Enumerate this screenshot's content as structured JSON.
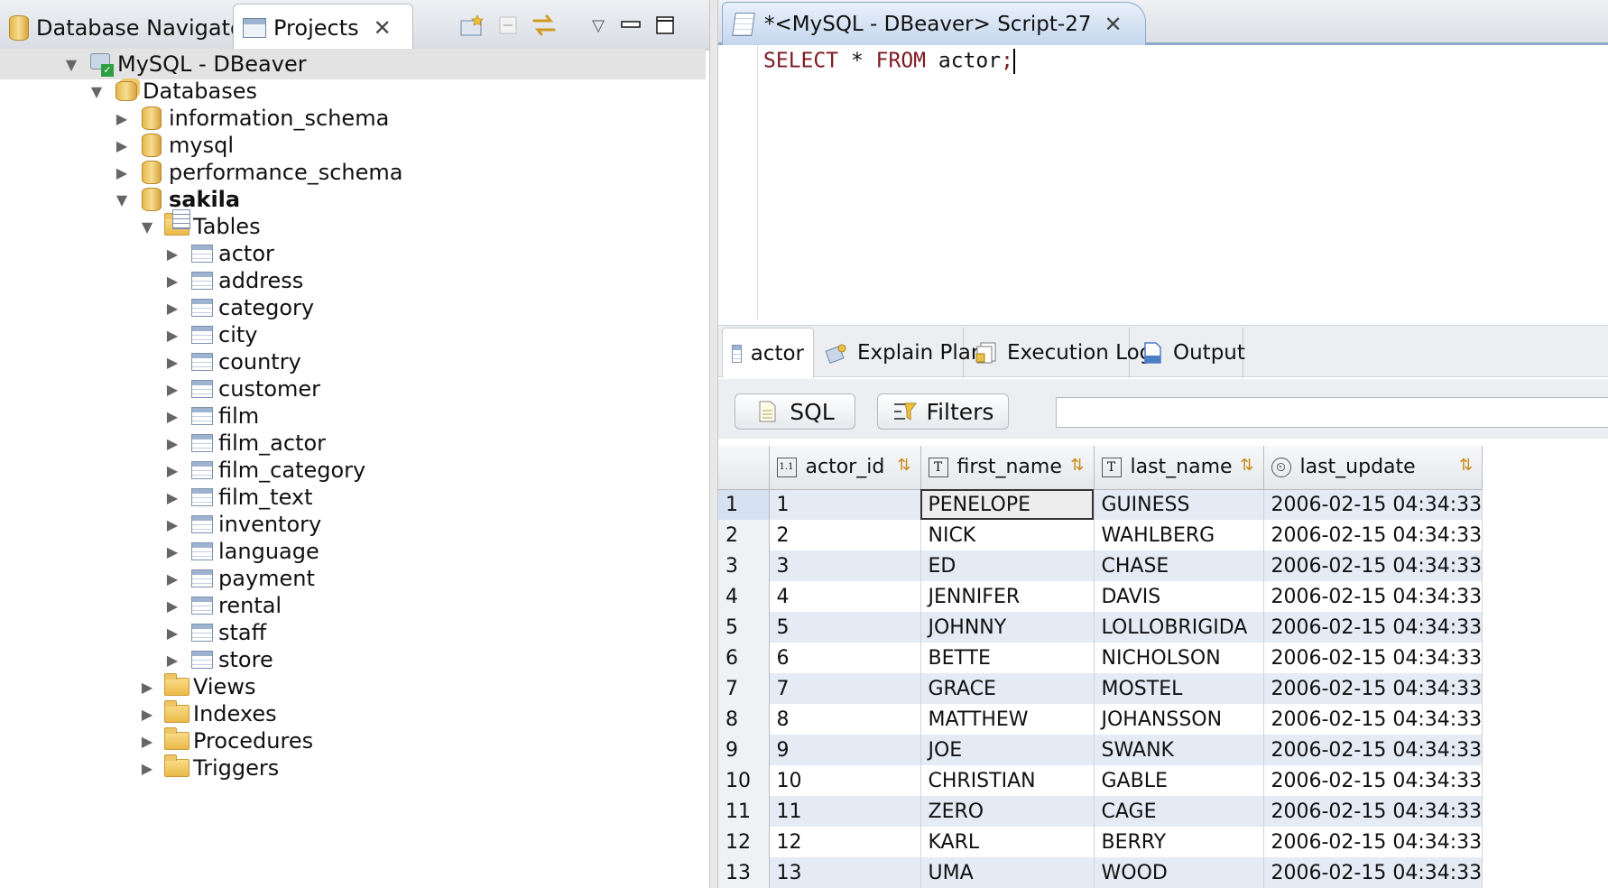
{
  "left_panel": {
    "tabs": [
      {
        "label": "Database Navigator",
        "icon": "database-navigator-icon"
      },
      {
        "label": "Projects",
        "icon": "projects-icon"
      }
    ],
    "toolbar_icons": [
      "new-folder-icon",
      "collapse-all-icon",
      "link-with-editor-icon",
      "view-menu-icon",
      "minimize-icon",
      "maximize-icon"
    ]
  },
  "tree": [
    {
      "label": "MySQL - DBeaver",
      "depth": 0,
      "expanded": true,
      "icon": "connection-icon",
      "selected": true
    },
    {
      "label": "Databases",
      "depth": 1,
      "expanded": true,
      "icon": "databases-icon"
    },
    {
      "label": "information_schema",
      "depth": 2,
      "expanded": false,
      "icon": "database-icon"
    },
    {
      "label": "mysql",
      "depth": 2,
      "expanded": false,
      "icon": "database-icon"
    },
    {
      "label": "performance_schema",
      "depth": 2,
      "expanded": false,
      "icon": "database-icon"
    },
    {
      "label": "sakila",
      "depth": 2,
      "expanded": true,
      "icon": "database-icon",
      "bold": true
    },
    {
      "label": "Tables",
      "depth": 3,
      "expanded": true,
      "icon": "tables-folder-icon"
    },
    {
      "label": "actor",
      "depth": 4,
      "expanded": false,
      "icon": "table-icon"
    },
    {
      "label": "address",
      "depth": 4,
      "expanded": false,
      "icon": "table-icon"
    },
    {
      "label": "category",
      "depth": 4,
      "expanded": false,
      "icon": "table-icon"
    },
    {
      "label": "city",
      "depth": 4,
      "expanded": false,
      "icon": "table-icon"
    },
    {
      "label": "country",
      "depth": 4,
      "expanded": false,
      "icon": "table-icon"
    },
    {
      "label": "customer",
      "depth": 4,
      "expanded": false,
      "icon": "table-icon"
    },
    {
      "label": "film",
      "depth": 4,
      "expanded": false,
      "icon": "table-icon"
    },
    {
      "label": "film_actor",
      "depth": 4,
      "expanded": false,
      "icon": "table-icon"
    },
    {
      "label": "film_category",
      "depth": 4,
      "expanded": false,
      "icon": "table-icon"
    },
    {
      "label": "film_text",
      "depth": 4,
      "expanded": false,
      "icon": "table-icon"
    },
    {
      "label": "inventory",
      "depth": 4,
      "expanded": false,
      "icon": "table-icon"
    },
    {
      "label": "language",
      "depth": 4,
      "expanded": false,
      "icon": "table-icon"
    },
    {
      "label": "payment",
      "depth": 4,
      "expanded": false,
      "icon": "table-icon"
    },
    {
      "label": "rental",
      "depth": 4,
      "expanded": false,
      "icon": "table-icon"
    },
    {
      "label": "staff",
      "depth": 4,
      "expanded": false,
      "icon": "table-icon"
    },
    {
      "label": "store",
      "depth": 4,
      "expanded": false,
      "icon": "table-icon"
    },
    {
      "label": "Views",
      "depth": 3,
      "expanded": false,
      "icon": "views-folder-icon"
    },
    {
      "label": "Indexes",
      "depth": 3,
      "expanded": false,
      "icon": "folder-icon"
    },
    {
      "label": "Procedures",
      "depth": 3,
      "expanded": false,
      "icon": "folder-icon"
    },
    {
      "label": "Triggers",
      "depth": 3,
      "expanded": false,
      "icon": "folder-icon"
    }
  ],
  "editor": {
    "tab_title": "*<MySQL - DBeaver> Script-27",
    "sql": {
      "kw1": "SELECT",
      "star": " * ",
      "kw2": "FROM",
      "rest": " actor",
      "semi": ";"
    }
  },
  "result_tabs": [
    {
      "label": "actor",
      "icon": "table-icon",
      "active": true
    },
    {
      "label": "Explain Plan",
      "icon": "explain-plan-icon"
    },
    {
      "label": "Execution Log",
      "icon": "execution-log-icon"
    },
    {
      "label": "Output",
      "icon": "output-icon"
    }
  ],
  "filter_bar": {
    "sql_button": "SQL",
    "filters_button": "Filters",
    "filter_value": ""
  },
  "grid": {
    "columns": [
      {
        "name": "actor_id",
        "type_icon": "1.1"
      },
      {
        "name": "first_name",
        "type_icon": "T"
      },
      {
        "name": "last_name",
        "type_icon": "T"
      },
      {
        "name": "last_update",
        "type_icon": "⏲"
      }
    ],
    "rows": [
      {
        "n": "1",
        "actor_id": "1",
        "first_name": "PENELOPE",
        "last_name": "GUINESS",
        "last_update": "2006-02-15 04:34:33"
      },
      {
        "n": "2",
        "actor_id": "2",
        "first_name": "NICK",
        "last_name": "WAHLBERG",
        "last_update": "2006-02-15 04:34:33"
      },
      {
        "n": "3",
        "actor_id": "3",
        "first_name": "ED",
        "last_name": "CHASE",
        "last_update": "2006-02-15 04:34:33"
      },
      {
        "n": "4",
        "actor_id": "4",
        "first_name": "JENNIFER",
        "last_name": "DAVIS",
        "last_update": "2006-02-15 04:34:33"
      },
      {
        "n": "5",
        "actor_id": "5",
        "first_name": "JOHNNY",
        "last_name": "LOLLOBRIGIDA",
        "last_update": "2006-02-15 04:34:33"
      },
      {
        "n": "6",
        "actor_id": "6",
        "first_name": "BETTE",
        "last_name": "NICHOLSON",
        "last_update": "2006-02-15 04:34:33"
      },
      {
        "n": "7",
        "actor_id": "7",
        "first_name": "GRACE",
        "last_name": "MOSTEL",
        "last_update": "2006-02-15 04:34:33"
      },
      {
        "n": "8",
        "actor_id": "8",
        "first_name": "MATTHEW",
        "last_name": "JOHANSSON",
        "last_update": "2006-02-15 04:34:33"
      },
      {
        "n": "9",
        "actor_id": "9",
        "first_name": "JOE",
        "last_name": "SWANK",
        "last_update": "2006-02-15 04:34:33"
      },
      {
        "n": "10",
        "actor_id": "10",
        "first_name": "CHRISTIAN",
        "last_name": "GABLE",
        "last_update": "2006-02-15 04:34:33"
      },
      {
        "n": "11",
        "actor_id": "11",
        "first_name": "ZERO",
        "last_name": "CAGE",
        "last_update": "2006-02-15 04:34:33"
      },
      {
        "n": "12",
        "actor_id": "12",
        "first_name": "KARL",
        "last_name": "BERRY",
        "last_update": "2006-02-15 04:34:33"
      },
      {
        "n": "13",
        "actor_id": "13",
        "first_name": "UMA",
        "last_name": "WOOD",
        "last_update": "2006-02-15 04:34:33"
      }
    ]
  },
  "colors": {
    "accent": "#8fa9cc",
    "keyword": "#7c1a22",
    "alt_row": "#e4ebf5",
    "selection": "#e3e3e3"
  }
}
